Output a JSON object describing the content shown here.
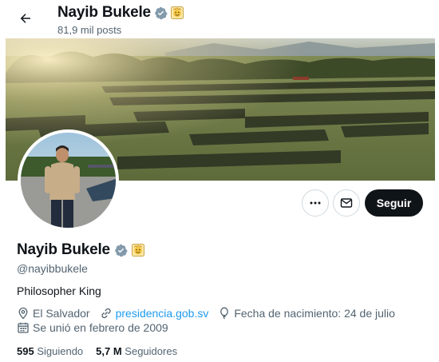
{
  "header": {
    "name": "Nayib Bukele",
    "posts_count": "81,9 mil posts"
  },
  "profile": {
    "name": "Nayib Bukele",
    "handle": "@nayibbukele",
    "bio": "Philosopher King",
    "location": "El Salvador",
    "website": "presidencia.gob.sv",
    "birthday": "Fecha de nacimiento: 24 de julio",
    "joined": "Se unió en febrero de 2009"
  },
  "stats": {
    "following_count": "595",
    "following_label": "Siguiendo",
    "followers_count": "5,7 M",
    "followers_label": "Seguidores"
  },
  "actions": {
    "follow_label": "Seguir"
  },
  "icons": {
    "back": "arrow-left-icon",
    "verified": "verified-badge-icon",
    "affiliate": "affiliate-emoji-icon",
    "more": "more-dots-icon",
    "message": "mail-icon",
    "location": "location-pin-icon",
    "link": "link-icon",
    "birthday": "balloon-icon",
    "calendar": "calendar-icon"
  },
  "colors": {
    "text_primary": "#0f1419",
    "text_secondary": "#536471",
    "link": "#1d9bf0",
    "verified": "#829aab",
    "follow_button_bg": "#0f1419"
  }
}
